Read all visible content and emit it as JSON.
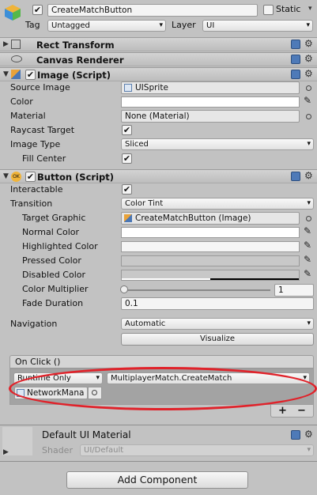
{
  "object": {
    "name": "CreateMatchButton",
    "static_label": "Static",
    "tag_label": "Tag",
    "tag_value": "Untagged",
    "layer_label": "Layer",
    "layer_value": "UI"
  },
  "components": {
    "rect_transform": "Rect Transform",
    "canvas_renderer": "Canvas Renderer",
    "image": {
      "title": "Image (Script)",
      "source_image_label": "Source Image",
      "source_image_value": "UISprite",
      "color_label": "Color",
      "material_label": "Material",
      "material_value": "None (Material)",
      "raycast_label": "Raycast Target",
      "image_type_label": "Image Type",
      "image_type_value": "Sliced",
      "fill_center_label": "Fill Center"
    },
    "button": {
      "title": "Button (Script)",
      "interactable_label": "Interactable",
      "transition_label": "Transition",
      "transition_value": "Color Tint",
      "target_graphic_label": "Target Graphic",
      "target_graphic_value": "CreateMatchButton (Image)",
      "normal_color_label": "Normal Color",
      "highlighted_color_label": "Highlighted Color",
      "pressed_color_label": "Pressed Color",
      "disabled_color_label": "Disabled Color",
      "color_multiplier_label": "Color Multiplier",
      "color_multiplier_value": "1",
      "fade_duration_label": "Fade Duration",
      "fade_duration_value": "0.1",
      "navigation_label": "Navigation",
      "navigation_value": "Automatic",
      "visualize_label": "Visualize"
    },
    "on_click": {
      "title": "On Click ()",
      "runtime_value": "Runtime Only",
      "function_value": "MultiplayerMatch.CreateMatch",
      "object_value": "NetworkMana",
      "add_label": "+",
      "remove_label": "−"
    },
    "material": {
      "title": "Default UI Material",
      "shader_label": "Shader",
      "shader_value": "UI/Default"
    }
  },
  "add_component_label": "Add Component",
  "colors": {
    "highlight_ring": "#e0222a",
    "panel_bg": "#c2c2c2"
  }
}
